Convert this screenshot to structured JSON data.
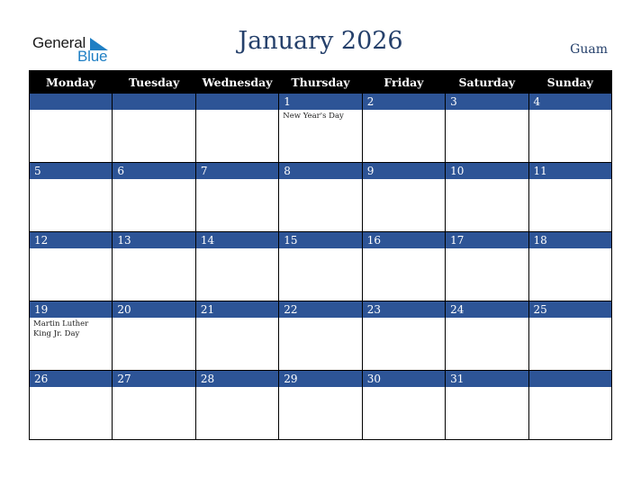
{
  "logo": {
    "word1": "General",
    "word2": "Blue",
    "icon": "triangle-flag-icon"
  },
  "header": {
    "title": "January 2026",
    "region": "Guam"
  },
  "colors": {
    "title": "#25406b",
    "daybar": "#2d5496",
    "header_bg": "#000000",
    "logo_blue": "#1f7fc4"
  },
  "weekdays": [
    "Monday",
    "Tuesday",
    "Wednesday",
    "Thursday",
    "Friday",
    "Saturday",
    "Sunday"
  ],
  "weeks": [
    [
      {
        "day": "",
        "holiday": ""
      },
      {
        "day": "",
        "holiday": ""
      },
      {
        "day": "",
        "holiday": ""
      },
      {
        "day": "1",
        "holiday": "New Year's Day"
      },
      {
        "day": "2",
        "holiday": ""
      },
      {
        "day": "3",
        "holiday": ""
      },
      {
        "day": "4",
        "holiday": ""
      }
    ],
    [
      {
        "day": "5",
        "holiday": ""
      },
      {
        "day": "6",
        "holiday": ""
      },
      {
        "day": "7",
        "holiday": ""
      },
      {
        "day": "8",
        "holiday": ""
      },
      {
        "day": "9",
        "holiday": ""
      },
      {
        "day": "10",
        "holiday": ""
      },
      {
        "day": "11",
        "holiday": ""
      }
    ],
    [
      {
        "day": "12",
        "holiday": ""
      },
      {
        "day": "13",
        "holiday": ""
      },
      {
        "day": "14",
        "holiday": ""
      },
      {
        "day": "15",
        "holiday": ""
      },
      {
        "day": "16",
        "holiday": ""
      },
      {
        "day": "17",
        "holiday": ""
      },
      {
        "day": "18",
        "holiday": ""
      }
    ],
    [
      {
        "day": "19",
        "holiday": "Martin Luther King Jr. Day"
      },
      {
        "day": "20",
        "holiday": ""
      },
      {
        "day": "21",
        "holiday": ""
      },
      {
        "day": "22",
        "holiday": ""
      },
      {
        "day": "23",
        "holiday": ""
      },
      {
        "day": "24",
        "holiday": ""
      },
      {
        "day": "25",
        "holiday": ""
      }
    ],
    [
      {
        "day": "26",
        "holiday": ""
      },
      {
        "day": "27",
        "holiday": ""
      },
      {
        "day": "28",
        "holiday": ""
      },
      {
        "day": "29",
        "holiday": ""
      },
      {
        "day": "30",
        "holiday": ""
      },
      {
        "day": "31",
        "holiday": ""
      },
      {
        "day": "",
        "holiday": ""
      }
    ]
  ]
}
